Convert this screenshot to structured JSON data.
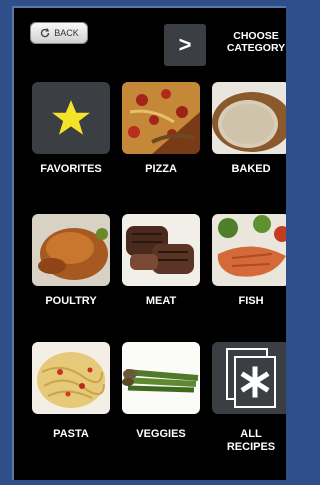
{
  "header": {
    "back_label": "BACK",
    "next_symbol": ">",
    "choose_line1": "CHOOSE",
    "choose_line2": "CATEGORY"
  },
  "categories": [
    {
      "label": "FAVORITES",
      "icon": "star-icon"
    },
    {
      "label": "PIZZA",
      "icon": "pizza-photo"
    },
    {
      "label": "BAKED",
      "icon": "bread-photo"
    },
    {
      "label": "POULTRY",
      "icon": "chicken-photo"
    },
    {
      "label": "MEAT",
      "icon": "steak-photo"
    },
    {
      "label": "FISH",
      "icon": "salmon-photo"
    },
    {
      "label": "PASTA",
      "icon": "pasta-photo"
    },
    {
      "label": "VEGGIES",
      "icon": "asparagus-photo"
    },
    {
      "label_line1": "ALL",
      "label_line2": "RECIPES",
      "icon": "recipe-cards-icon"
    }
  ],
  "colors": {
    "background": "#2e4f8a",
    "screen": "#000000",
    "tile": "#3b3f44",
    "star": "#f5e32a"
  }
}
